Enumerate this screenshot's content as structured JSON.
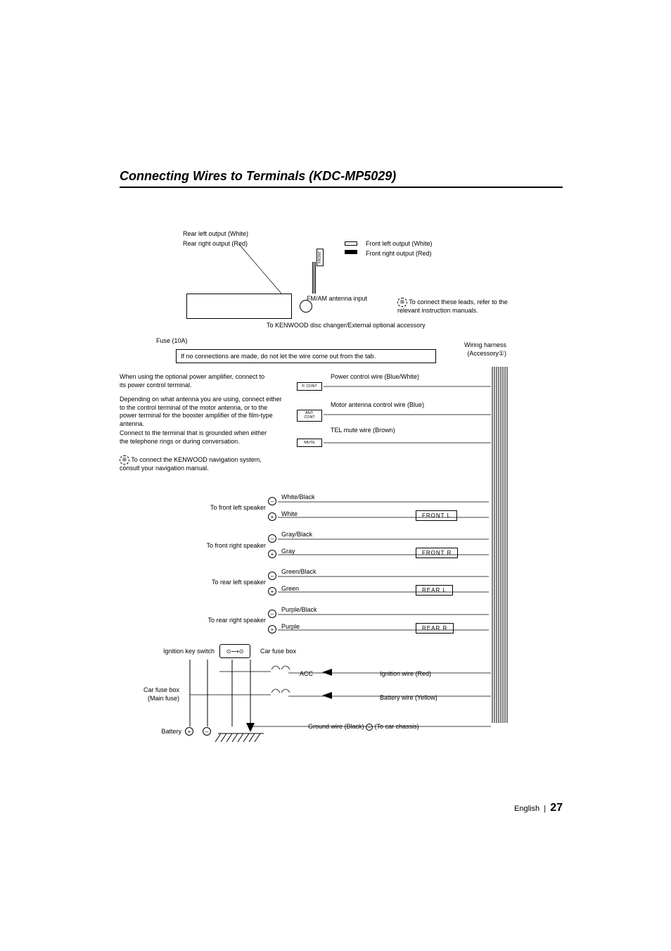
{
  "page": {
    "title": "Connecting Wires to Terminals (KDC-MP5029)",
    "footer_lang": "English",
    "footer_sep": "|",
    "footer_page": "27"
  },
  "top": {
    "rear_left": "Rear left output (White)",
    "rear_right": "Rear right output (Red)",
    "front_left": "Front left output (White)",
    "front_right": "Front right output (Red)",
    "fm_am": "FM/AM antenna input",
    "leads_note": "To connect these leads, refer to the relevant instruction manuals.",
    "disc_changer": "To KENWOOD disc changer/External optional accessory",
    "fuse": "Fuse (10A)",
    "front_vert": "FRONT"
  },
  "mid": {
    "tab_note": "If no connections are made, do not let the wire come out from the tab.",
    "harness": "Wiring harness (Accessory①)",
    "power_amp": "When using the optional power amplifier, connect to its power control terminal.",
    "antenna": "Depending on what antenna you are using, connect either to the control terminal of the motor antenna, or to the power terminal for the booster amplifier of the film-type antenna.",
    "telephone": "Connect to the terminal that is grounded when either the telephone rings or during conversation.",
    "navigation": "To connect the KENWOOD navigation system, consult your navigation manual.",
    "pcont": "P. CONT",
    "antcont": "ANT. CONT",
    "mute": "MUTE",
    "power_wire": "Power control wire (Blue/White)",
    "motor_wire": "Motor antenna control wire (Blue)",
    "tel_wire": "TEL mute wire (Brown)"
  },
  "speakers": {
    "fl": {
      "dest": "To front left speaker",
      "neg": "White/Black",
      "pos": "White",
      "box": "FRONT  L"
    },
    "fr": {
      "dest": "To front right speaker",
      "neg": "Gray/Black",
      "pos": "Gray",
      "box": "FRONT  R"
    },
    "rl": {
      "dest": "To rear left speaker",
      "neg": "Green/Black",
      "pos": "Green",
      "box": "REAR  L"
    },
    "rr": {
      "dest": "To rear right speaker",
      "neg": "Purple/Black",
      "pos": "Purple",
      "box": "REAR  R"
    }
  },
  "bottom": {
    "ignition_key": "Ignition key switch",
    "car_fuse": "Car fuse box",
    "main_fuse_1": "Car fuse box",
    "main_fuse_2": "(Main fuse)",
    "battery": "Battery",
    "acc": "ACC",
    "ignition_wire": "Ignition wire (Red)",
    "battery_wire": "Battery wire (Yellow)",
    "ground_wire": "Ground wire (Black)",
    "to_chassis": "(To car chassis)"
  }
}
